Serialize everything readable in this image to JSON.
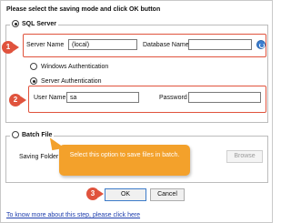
{
  "dialog": {
    "prompt": "Please select the saving mode and click OK button"
  },
  "sql_group": {
    "title": "SQL Server",
    "server_name_label": "Server Name",
    "server_name_value": "(local)",
    "database_name_label": "Database Name",
    "database_name_value": "",
    "windows_auth_label": "Windows Authentication",
    "server_auth_label": "Server Authentication",
    "user_name_label": "User Name",
    "user_name_value": "sa",
    "password_label": "Password",
    "password_value": ""
  },
  "batch_group": {
    "title": "Batch File",
    "saving_folder_label": "Saving Folder",
    "browse_label": "Browse"
  },
  "callout": {
    "text": "Select this option to save files in batch."
  },
  "badges": {
    "one": "1",
    "two": "2",
    "three": "3"
  },
  "buttons": {
    "ok_label": "OK",
    "cancel_label": "Cancel"
  },
  "footer": {
    "help_link": "To know more about this step, please click here"
  },
  "colors": {
    "highlight": "#e0533d",
    "callout": "#f3a12b",
    "link": "#1f3fae"
  },
  "icons": {
    "refresh": "refresh-icon"
  }
}
